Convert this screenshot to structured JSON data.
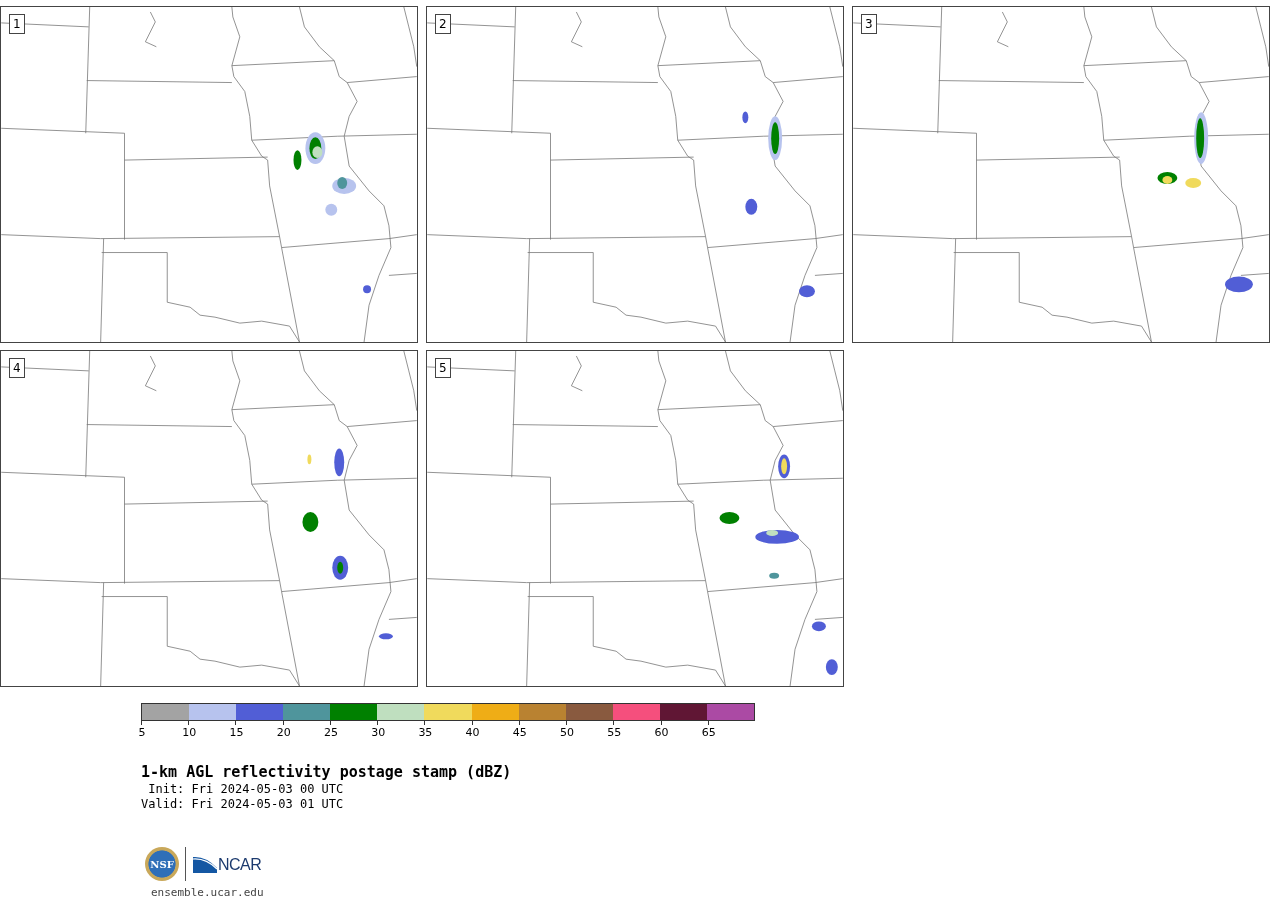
{
  "panels": [
    {
      "label": "1"
    },
    {
      "label": "2"
    },
    {
      "label": "3"
    },
    {
      "label": "4"
    },
    {
      "label": "5"
    }
  ],
  "colorbar": {
    "bins": [
      {
        "color": "#a3a3a3"
      },
      {
        "color": "#b7c3ee"
      },
      {
        "color": "#515ed6"
      },
      {
        "color": "#4f959c"
      },
      {
        "color": "#008000"
      },
      {
        "color": "#bfdfbf"
      },
      {
        "color": "#f0da5c"
      },
      {
        "color": "#efad16"
      },
      {
        "color": "#b98231"
      },
      {
        "color": "#895a3f"
      },
      {
        "color": "#f54f7d"
      },
      {
        "color": "#601634"
      },
      {
        "color": "#ab4aa4"
      }
    ],
    "ticks": [
      "5",
      "10",
      "15",
      "20",
      "25",
      "30",
      "35",
      "40",
      "45",
      "50",
      "55",
      "60",
      "65"
    ]
  },
  "title": "1-km AGL reflectivity postage stamp (dBZ)",
  "times": [
    {
      "label": "Init:",
      "value": "Fri 2024-05-03 00 UTC"
    },
    {
      "label": "Valid:",
      "value": "Fri 2024-05-03 01 UTC"
    }
  ],
  "logos": {
    "nsf": "NSF",
    "ncar": "NCAR"
  },
  "url": "ensemble.ucar.edu"
}
